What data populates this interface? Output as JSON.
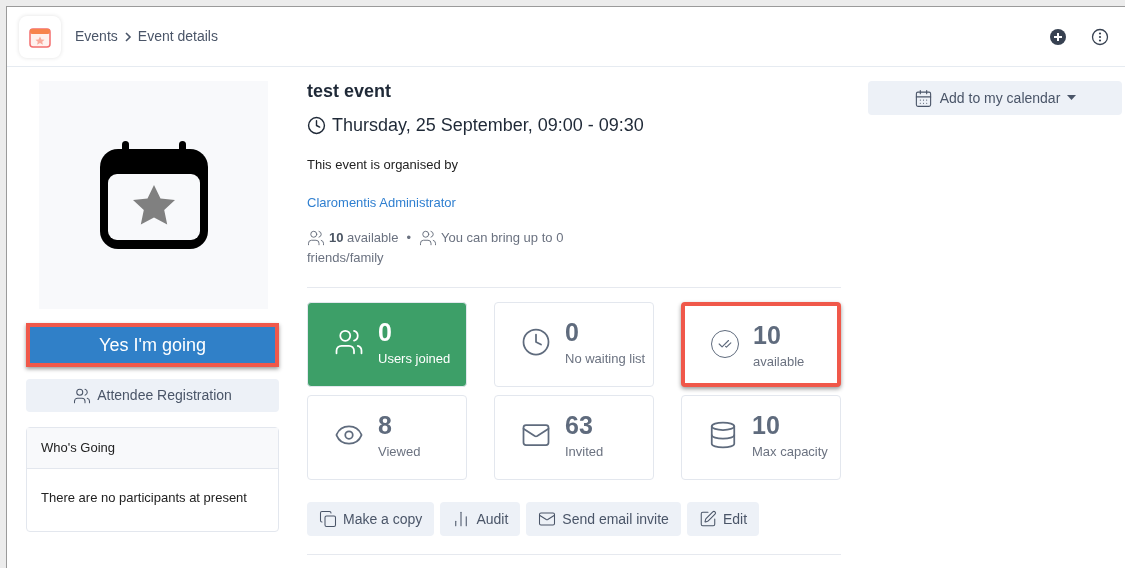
{
  "breadcrumb": [
    "Events",
    "Event details"
  ],
  "event": {
    "title": "test event",
    "datetime": "Thursday, 25 September, 09:00 - 09:30",
    "organised_by": "This event is organised by",
    "organiser": "Claromentis Administrator",
    "available_count": "10",
    "available_label": "available",
    "separator": "•",
    "bring_up_lines": [
      "You can bring up to 0",
      "friends/family"
    ]
  },
  "rsvp_button": {
    "label": "Yes I'm going",
    "highlighted": true
  },
  "registration_button": "Attendee Registration",
  "whos_going": {
    "title": "Who's Going",
    "message": "There are no participants at present"
  },
  "stats": [
    {
      "kind": "users",
      "value": "0",
      "label": "Users joined",
      "filled": true,
      "highlighted": false
    },
    {
      "kind": "clock",
      "value": "0",
      "label": "No waiting list",
      "filled": false,
      "highlighted": false
    },
    {
      "kind": "check",
      "value": "10",
      "label": "available",
      "filled": false,
      "highlighted": true
    },
    {
      "kind": "eye",
      "value": "8",
      "label": "Viewed",
      "filled": false,
      "highlighted": false
    },
    {
      "kind": "mail",
      "value": "63",
      "label": "Invited",
      "filled": false,
      "highlighted": false
    },
    {
      "kind": "database",
      "value": "10",
      "label": "Max capacity",
      "filled": false,
      "highlighted": false
    }
  ],
  "actions": [
    {
      "kind": "copy",
      "label": "Make a copy"
    },
    {
      "kind": "chart",
      "label": "Audit"
    },
    {
      "kind": "mail",
      "label": "Send email invite"
    },
    {
      "kind": "edit",
      "label": "Edit"
    }
  ],
  "calendar_button": "Add to my calendar"
}
